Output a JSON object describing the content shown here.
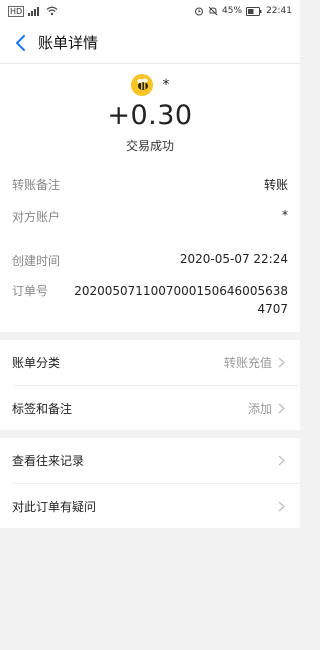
{
  "status_bar": {
    "left_text": "HD",
    "battery_text": "45%",
    "time": "22:41"
  },
  "header": {
    "title": "账单详情"
  },
  "summary": {
    "merchant_name": "*",
    "amount": "+0.30",
    "status": "交易成功"
  },
  "details": {
    "note_label": "转账备注",
    "note_value": "转账",
    "account_label": "对方账户",
    "account_value": "*",
    "created_label": "创建时间",
    "created_value": "2020-05-07 22:24",
    "order_label": "订单号",
    "order_value": "2020050711007000150646005638 4707"
  },
  "section1": {
    "category_label": "账单分类",
    "category_value": "转账充值",
    "tags_label": "标签和备注",
    "tags_value": "添加"
  },
  "section2": {
    "history_label": "查看往来记录",
    "question_label": "对此订单有疑问"
  },
  "colors": {
    "accent": "#1677ff",
    "label": "#888888",
    "text": "#222222",
    "background": "#f2f2f2",
    "avatar": "#f7c325"
  }
}
